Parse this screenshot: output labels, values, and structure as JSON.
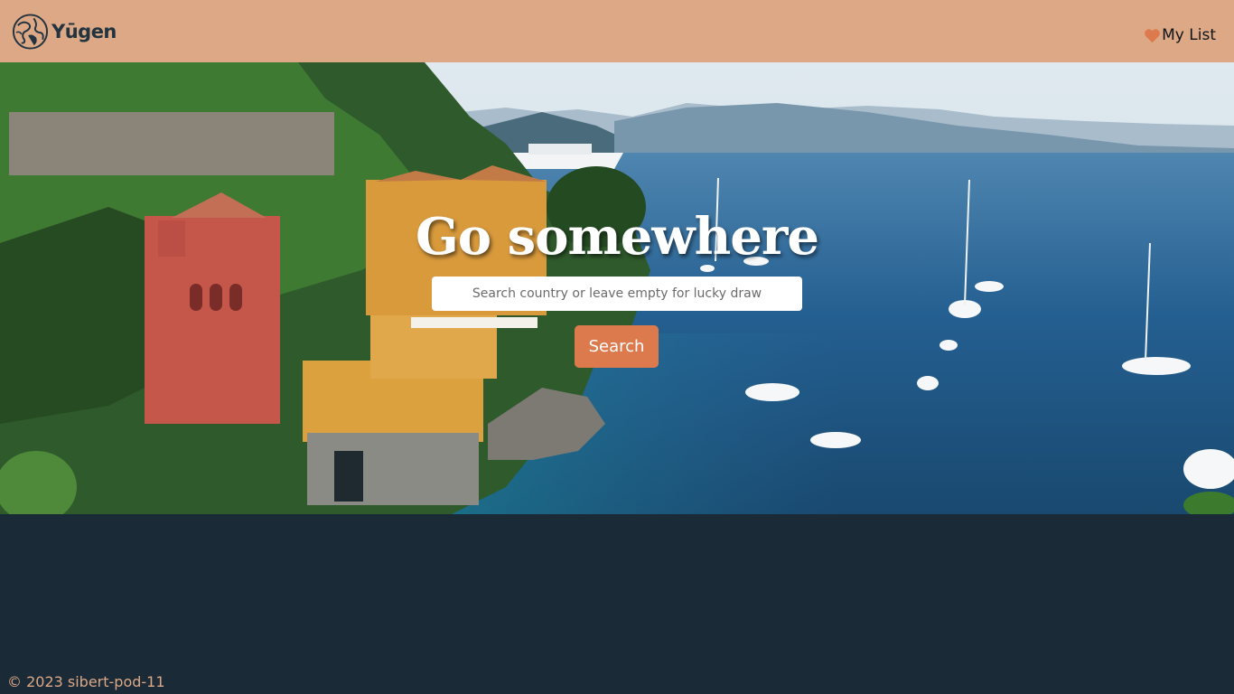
{
  "header": {
    "brand_name": "Yūgen",
    "logo_icon": "globe-icon",
    "my_list_icon": "heart-icon",
    "my_list_label": "My List"
  },
  "hero": {
    "image_description": "coastal village with colorful villas, sea and boats",
    "title": "Go somewhere",
    "search_placeholder": "Search country or leave empty for lucky draw",
    "search_value": "",
    "search_button_label": "Search"
  },
  "footer": {
    "copyright": "© 2023 sibert-pod-11"
  },
  "colors": {
    "header_bg": "#dca886",
    "page_bg": "#1a2a37",
    "accent": "#dc7a4d",
    "footer_text": "#dca886"
  }
}
